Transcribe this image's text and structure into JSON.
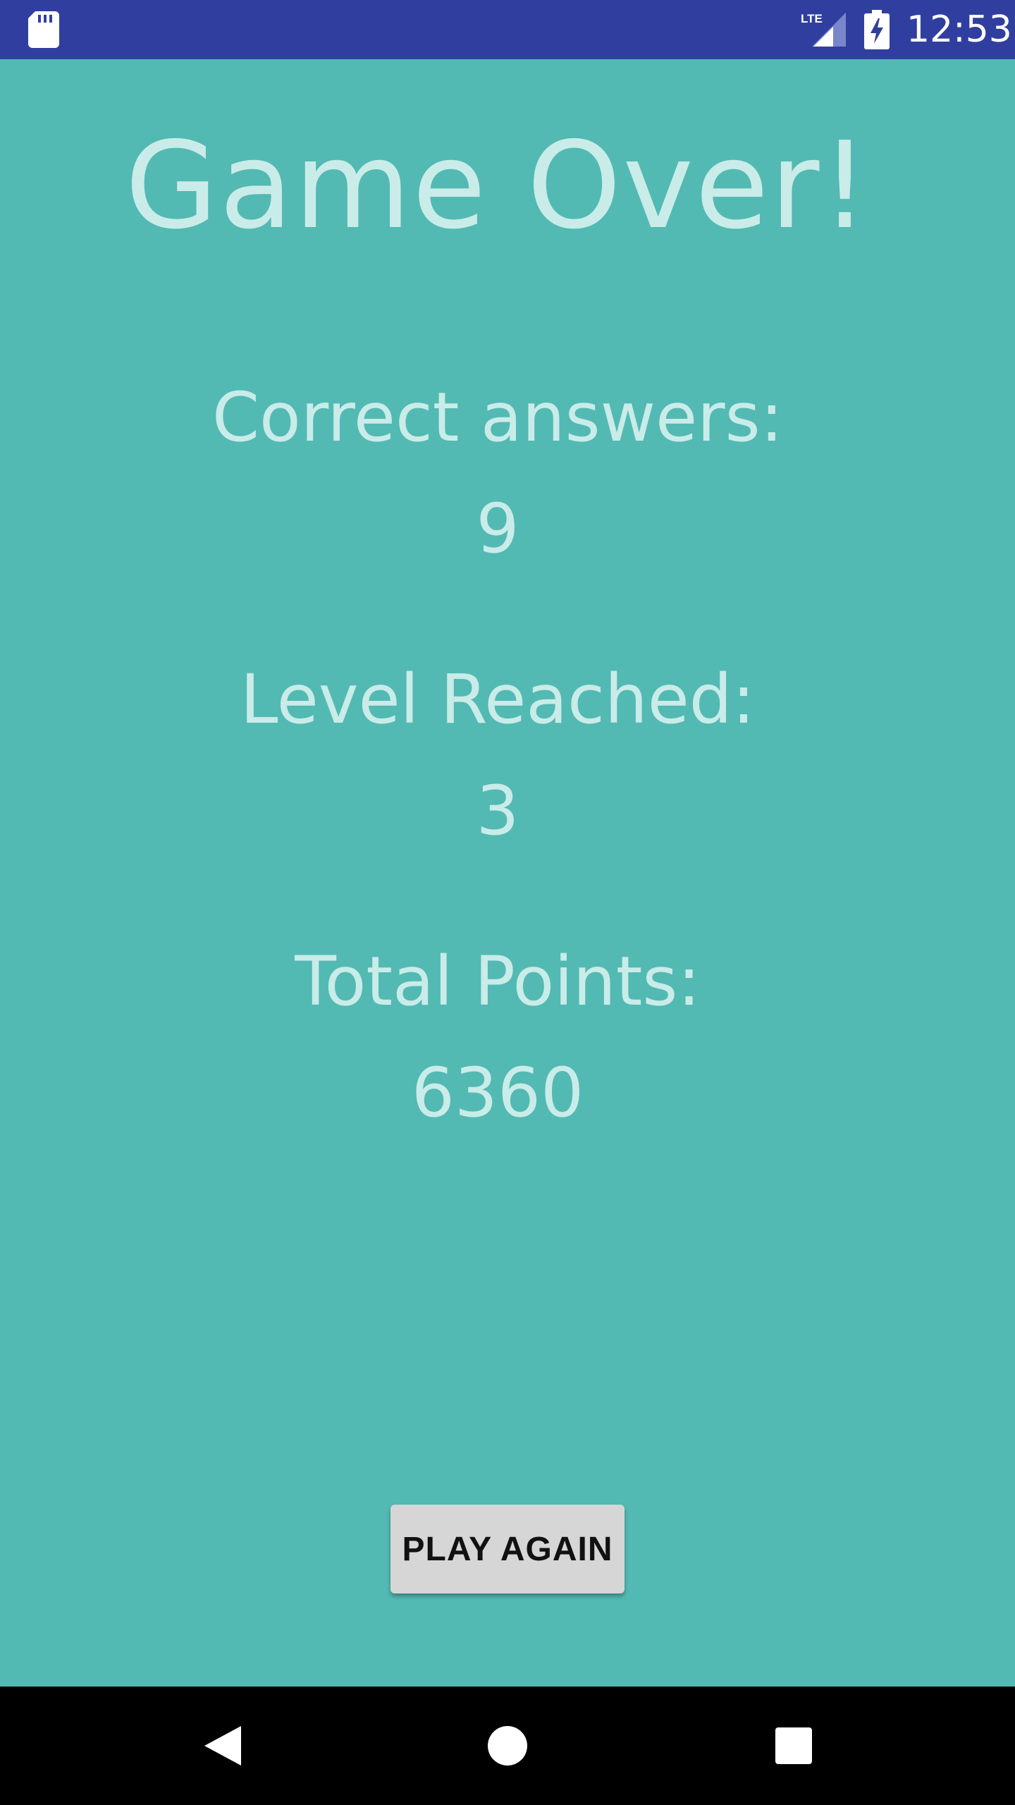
{
  "status_bar": {
    "time": "12:53",
    "network_label": "LTE",
    "icons": [
      "sd-card-icon",
      "lte-signal-icon",
      "battery-charging-icon"
    ],
    "background_color": "#303f9f"
  },
  "screen": {
    "background_color": "#53b9b3",
    "text_color": "#c9ece9",
    "title": "Game Over!",
    "stats": [
      {
        "label": "Correct answers:",
        "value": "9"
      },
      {
        "label": "Level Reached:",
        "value": "3"
      },
      {
        "label": "Total Points:",
        "value": "6360"
      }
    ],
    "play_again_label": "PLAY AGAIN"
  },
  "nav_bar": {
    "buttons": [
      "back-icon",
      "home-icon",
      "recents-icon"
    ]
  }
}
